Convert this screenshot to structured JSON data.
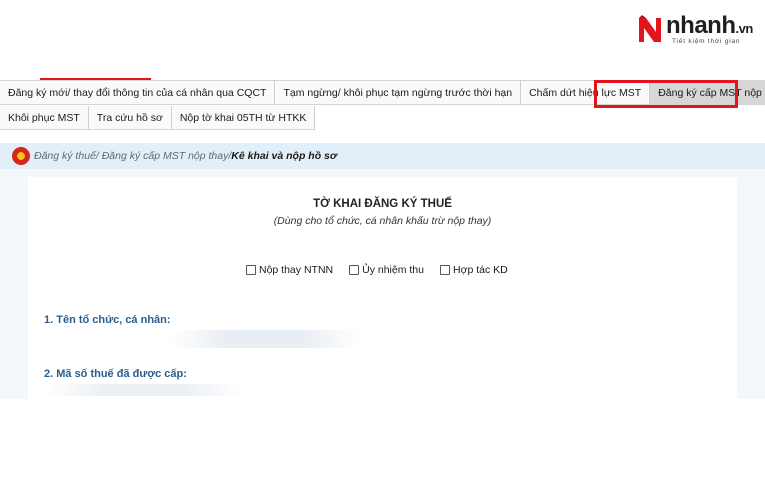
{
  "logo": {
    "brand": "nhanh",
    "suffix": ".vn",
    "slogan": "Tiết kiệm thời gian",
    "brand_color": "#e3151c"
  },
  "tabs": {
    "row1": [
      "Đăng ký mới/ thay đổi thông tin của cá nhân qua CQCT",
      "Tạm ngừng/ khôi phục tạm ngừng trước thời hạn",
      "Chấm dứt hiệu lực MST",
      "Đăng ký cấp MST nộp thay"
    ],
    "row2": [
      "Khôi phục MST",
      "Tra cứu hồ sơ",
      "Nộp tờ khai 05TH từ HTKK"
    ],
    "active": "Đăng ký cấp MST nộp thay"
  },
  "breadcrumb": {
    "path": "Đăng ký thuế/ Đăng ký cấp MST nộp thay/ ",
    "current": "Kê khai và nộp hồ sơ"
  },
  "form": {
    "title": "TỜ KHAI ĐĂNG KÝ THUẾ",
    "subtitle": "(Dùng cho tổ chức, cá nhân khấu trừ nộp thay)",
    "checkboxes": [
      {
        "label": "Nộp thay NTNN",
        "checked": false
      },
      {
        "label": "Ủy nhiệm thu",
        "checked": false
      },
      {
        "label": "Hợp tác KD",
        "checked": false
      }
    ],
    "section1": "1. Tên tổ chức, cá nhân:",
    "section2": "2. Mã số thuế đã được cấp:"
  },
  "colors": {
    "highlight": "#e3151c",
    "breadcrumb_bg": "#e3eff8",
    "section_label": "#2b5d8f"
  }
}
